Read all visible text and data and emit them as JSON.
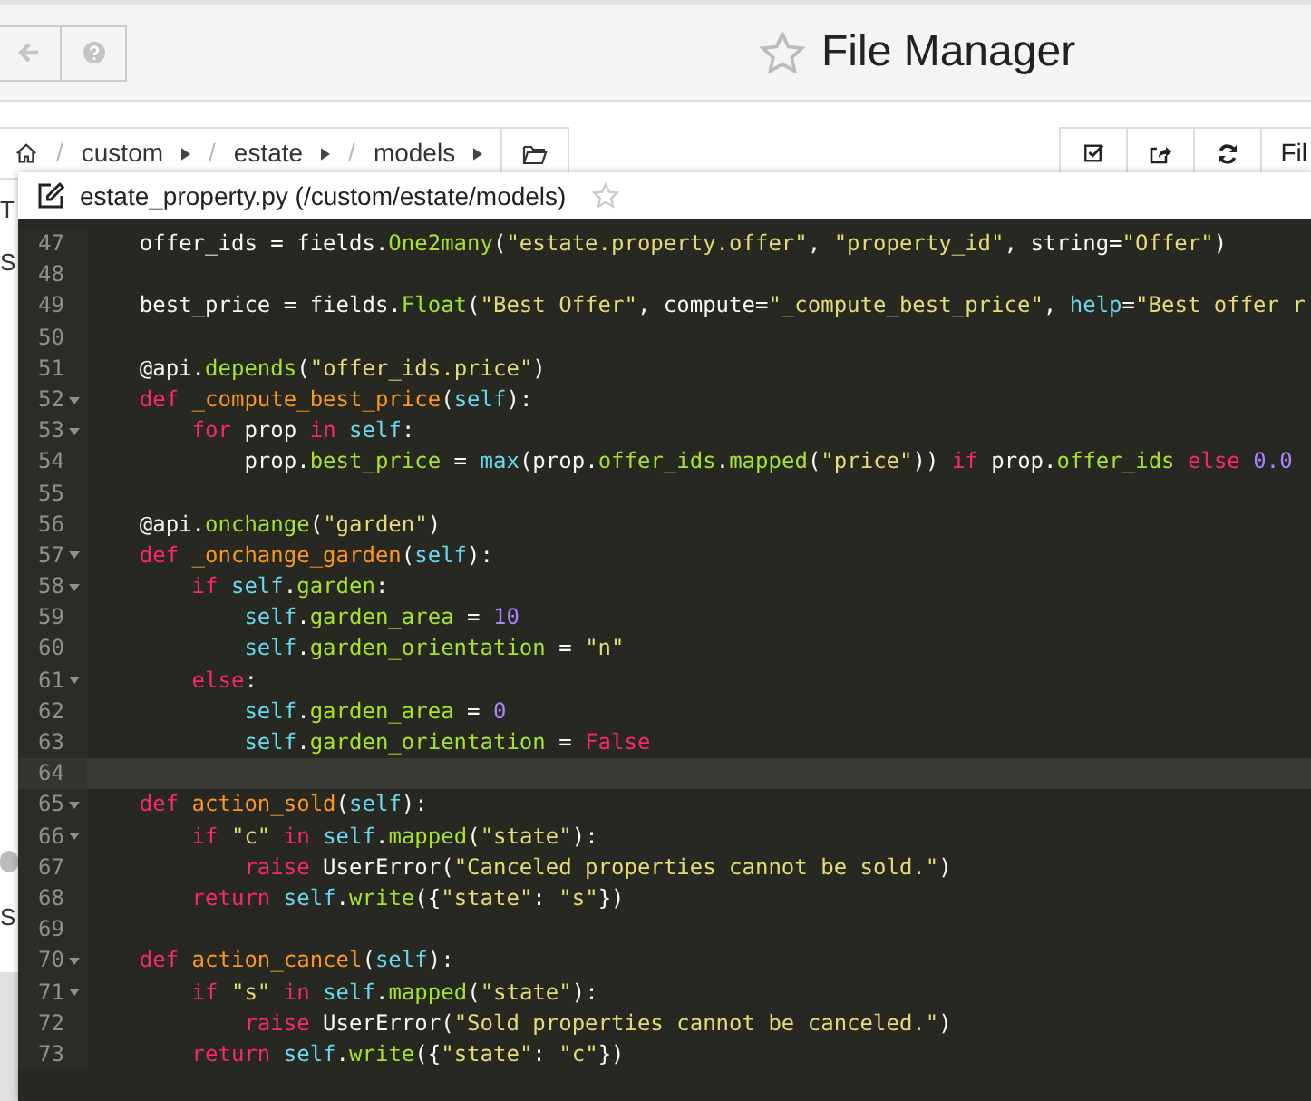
{
  "header": {
    "title": "File Manager",
    "favorite": false
  },
  "breadcrumb": {
    "segments": [
      {
        "separator": "/",
        "label": "custom"
      },
      {
        "separator": "/",
        "label": "estate"
      },
      {
        "separator": "/",
        "label": "models"
      }
    ]
  },
  "toolbar": {
    "button_label": "Fil"
  },
  "background_fragments": [
    {
      "text": "T"
    },
    {
      "text": "S"
    },
    {
      "text": "S"
    }
  ],
  "editor": {
    "title": "estate_property.py (/custom/estate/models)",
    "favorite": false,
    "lines": [
      {
        "number": "47",
        "foldable": false,
        "active": false,
        "tokens": [
          {
            "kind": "p",
            "text": "    offer_ids = fields."
          },
          {
            "kind": "f",
            "text": "One2many"
          },
          {
            "kind": "p",
            "text": "("
          },
          {
            "kind": "s",
            "text": "\"estate.property.offer\""
          },
          {
            "kind": "p",
            "text": ", "
          },
          {
            "kind": "s",
            "text": "\"property_id\""
          },
          {
            "kind": "p",
            "text": ", string="
          },
          {
            "kind": "s",
            "text": "\"Offer\""
          },
          {
            "kind": "p",
            "text": ")"
          }
        ]
      },
      {
        "number": "48",
        "foldable": false,
        "active": false
      },
      {
        "number": "49",
        "foldable": false,
        "active": false,
        "tokens": [
          {
            "kind": "p",
            "text": "    best_price = fields."
          },
          {
            "kind": "f",
            "text": "Float"
          },
          {
            "kind": "p",
            "text": "("
          },
          {
            "kind": "s",
            "text": "\"Best Offer\""
          },
          {
            "kind": "p",
            "text": ", compute="
          },
          {
            "kind": "s",
            "text": "\"_compute_best_price\""
          },
          {
            "kind": "p",
            "text": ", "
          },
          {
            "kind": "c",
            "text": "help"
          },
          {
            "kind": "p",
            "text": "="
          },
          {
            "kind": "s",
            "text": "\"Best offer r"
          }
        ]
      },
      {
        "number": "50",
        "foldable": false,
        "active": false
      },
      {
        "number": "51",
        "foldable": false,
        "active": false,
        "tokens": [
          {
            "kind": "p",
            "text": "    @api."
          },
          {
            "kind": "f",
            "text": "depends"
          },
          {
            "kind": "p",
            "text": "("
          },
          {
            "kind": "s",
            "text": "\"offer_ids.price\""
          },
          {
            "kind": "p",
            "text": ")"
          }
        ]
      },
      {
        "number": "52",
        "foldable": true,
        "active": false,
        "tokens": [
          {
            "kind": "k",
            "text": "    def "
          },
          {
            "kind": "d",
            "text": "_compute_best_price"
          },
          {
            "kind": "p",
            "text": "("
          },
          {
            "kind": "c",
            "text": "self"
          },
          {
            "kind": "p",
            "text": "):"
          }
        ]
      },
      {
        "number": "53",
        "foldable": true,
        "active": false,
        "tokens": [
          {
            "kind": "k",
            "text": "        for"
          },
          {
            "kind": "p",
            "text": " prop "
          },
          {
            "kind": "k",
            "text": "in "
          },
          {
            "kind": "c",
            "text": "self"
          },
          {
            "kind": "p",
            "text": ":"
          }
        ]
      },
      {
        "number": "54",
        "foldable": false,
        "active": false,
        "tokens": [
          {
            "kind": "p",
            "text": "            prop."
          },
          {
            "kind": "f",
            "text": "best_price"
          },
          {
            "kind": "p",
            "text": " = "
          },
          {
            "kind": "c",
            "text": "max"
          },
          {
            "kind": "p",
            "text": "(prop."
          },
          {
            "kind": "f",
            "text": "offer_ids"
          },
          {
            "kind": "p",
            "text": "."
          },
          {
            "kind": "f",
            "text": "mapped"
          },
          {
            "kind": "p",
            "text": "("
          },
          {
            "kind": "s",
            "text": "\"price\""
          },
          {
            "kind": "p",
            "text": ")) "
          },
          {
            "kind": "k",
            "text": "if"
          },
          {
            "kind": "p",
            "text": " prop."
          },
          {
            "kind": "f",
            "text": "offer_ids"
          },
          {
            "kind": "k",
            "text": " else "
          },
          {
            "kind": "n",
            "text": "0.0"
          }
        ]
      },
      {
        "number": "55",
        "foldable": false,
        "active": false
      },
      {
        "number": "56",
        "foldable": false,
        "active": false,
        "tokens": [
          {
            "kind": "p",
            "text": "    @api."
          },
          {
            "kind": "f",
            "text": "onchange"
          },
          {
            "kind": "p",
            "text": "("
          },
          {
            "kind": "s",
            "text": "\"garden\""
          },
          {
            "kind": "p",
            "text": ")"
          }
        ]
      },
      {
        "number": "57",
        "foldable": true,
        "active": false,
        "tokens": [
          {
            "kind": "k",
            "text": "    def "
          },
          {
            "kind": "d",
            "text": "_onchange_garden"
          },
          {
            "kind": "p",
            "text": "("
          },
          {
            "kind": "c",
            "text": "self"
          },
          {
            "kind": "p",
            "text": "):"
          }
        ]
      },
      {
        "number": "58",
        "foldable": true,
        "active": false,
        "tokens": [
          {
            "kind": "k",
            "text": "        if "
          },
          {
            "kind": "c",
            "text": "self"
          },
          {
            "kind": "p",
            "text": "."
          },
          {
            "kind": "f",
            "text": "garden"
          },
          {
            "kind": "p",
            "text": ":"
          }
        ]
      },
      {
        "number": "59",
        "foldable": false,
        "active": false,
        "tokens": [
          {
            "kind": "c",
            "text": "            self"
          },
          {
            "kind": "p",
            "text": "."
          },
          {
            "kind": "f",
            "text": "garden_area"
          },
          {
            "kind": "p",
            "text": " = "
          },
          {
            "kind": "n",
            "text": "10"
          }
        ]
      },
      {
        "number": "60",
        "foldable": false,
        "active": false,
        "tokens": [
          {
            "kind": "c",
            "text": "            self"
          },
          {
            "kind": "p",
            "text": "."
          },
          {
            "kind": "f",
            "text": "garden_orientation"
          },
          {
            "kind": "p",
            "text": " = "
          },
          {
            "kind": "s",
            "text": "\"n\""
          }
        ]
      },
      {
        "number": "61",
        "foldable": true,
        "active": false,
        "tokens": [
          {
            "kind": "k",
            "text": "        else"
          },
          {
            "kind": "p",
            "text": ":"
          }
        ]
      },
      {
        "number": "62",
        "foldable": false,
        "active": false,
        "tokens": [
          {
            "kind": "c",
            "text": "            self"
          },
          {
            "kind": "p",
            "text": "."
          },
          {
            "kind": "f",
            "text": "garden_area"
          },
          {
            "kind": "p",
            "text": " = "
          },
          {
            "kind": "n",
            "text": "0"
          }
        ]
      },
      {
        "number": "63",
        "foldable": false,
        "active": false,
        "tokens": [
          {
            "kind": "c",
            "text": "            self"
          },
          {
            "kind": "p",
            "text": "."
          },
          {
            "kind": "f",
            "text": "garden_orientation"
          },
          {
            "kind": "p",
            "text": " = "
          },
          {
            "kind": "k",
            "text": "False"
          }
        ]
      },
      {
        "number": "64",
        "foldable": false,
        "active": true
      },
      {
        "number": "65",
        "foldable": true,
        "active": false,
        "tokens": [
          {
            "kind": "k",
            "text": "    def "
          },
          {
            "kind": "d",
            "text": "action_sold"
          },
          {
            "kind": "p",
            "text": "("
          },
          {
            "kind": "c",
            "text": "self"
          },
          {
            "kind": "p",
            "text": "):"
          }
        ]
      },
      {
        "number": "66",
        "foldable": true,
        "active": false,
        "tokens": [
          {
            "kind": "k",
            "text": "        if "
          },
          {
            "kind": "s",
            "text": "\"c\""
          },
          {
            "kind": "k",
            "text": " in "
          },
          {
            "kind": "c",
            "text": "self"
          },
          {
            "kind": "p",
            "text": "."
          },
          {
            "kind": "f",
            "text": "mapped"
          },
          {
            "kind": "p",
            "text": "("
          },
          {
            "kind": "s",
            "text": "\"state\""
          },
          {
            "kind": "p",
            "text": "):"
          }
        ]
      },
      {
        "number": "67",
        "foldable": false,
        "active": false,
        "tokens": [
          {
            "kind": "k",
            "text": "            raise"
          },
          {
            "kind": "p",
            "text": " UserError("
          },
          {
            "kind": "s",
            "text": "\"Canceled properties cannot be sold.\""
          },
          {
            "kind": "p",
            "text": ")"
          }
        ]
      },
      {
        "number": "68",
        "foldable": false,
        "active": false,
        "tokens": [
          {
            "kind": "k",
            "text": "        return "
          },
          {
            "kind": "c",
            "text": "self"
          },
          {
            "kind": "p",
            "text": "."
          },
          {
            "kind": "f",
            "text": "write"
          },
          {
            "kind": "p",
            "text": "({"
          },
          {
            "kind": "s",
            "text": "\"state\""
          },
          {
            "kind": "p",
            "text": ": "
          },
          {
            "kind": "s",
            "text": "\"s\""
          },
          {
            "kind": "p",
            "text": "})"
          }
        ]
      },
      {
        "number": "69",
        "foldable": false,
        "active": false
      },
      {
        "number": "70",
        "foldable": true,
        "active": false,
        "tokens": [
          {
            "kind": "k",
            "text": "    def "
          },
          {
            "kind": "d",
            "text": "action_cancel"
          },
          {
            "kind": "p",
            "text": "("
          },
          {
            "kind": "c",
            "text": "self"
          },
          {
            "kind": "p",
            "text": "):"
          }
        ]
      },
      {
        "number": "71",
        "foldable": true,
        "active": false,
        "tokens": [
          {
            "kind": "k",
            "text": "        if "
          },
          {
            "kind": "s",
            "text": "\"s\""
          },
          {
            "kind": "k",
            "text": " in "
          },
          {
            "kind": "c",
            "text": "self"
          },
          {
            "kind": "p",
            "text": "."
          },
          {
            "kind": "f",
            "text": "mapped"
          },
          {
            "kind": "p",
            "text": "("
          },
          {
            "kind": "s",
            "text": "\"state\""
          },
          {
            "kind": "p",
            "text": "):"
          }
        ]
      },
      {
        "number": "72",
        "foldable": false,
        "active": false,
        "tokens": [
          {
            "kind": "k",
            "text": "            raise"
          },
          {
            "kind": "p",
            "text": " UserError("
          },
          {
            "kind": "s",
            "text": "\"Sold properties cannot be canceled.\""
          },
          {
            "kind": "p",
            "text": ")"
          }
        ]
      },
      {
        "number": "73",
        "foldable": false,
        "active": false,
        "tokens": [
          {
            "kind": "k",
            "text": "        return "
          },
          {
            "kind": "c",
            "text": "self"
          },
          {
            "kind": "p",
            "text": "."
          },
          {
            "kind": "f",
            "text": "write"
          },
          {
            "kind": "p",
            "text": "({"
          },
          {
            "kind": "s",
            "text": "\"state\""
          },
          {
            "kind": "p",
            "text": ": "
          },
          {
            "kind": "s",
            "text": "\"c\""
          },
          {
            "kind": "p",
            "text": "})"
          }
        ]
      }
    ]
  }
}
